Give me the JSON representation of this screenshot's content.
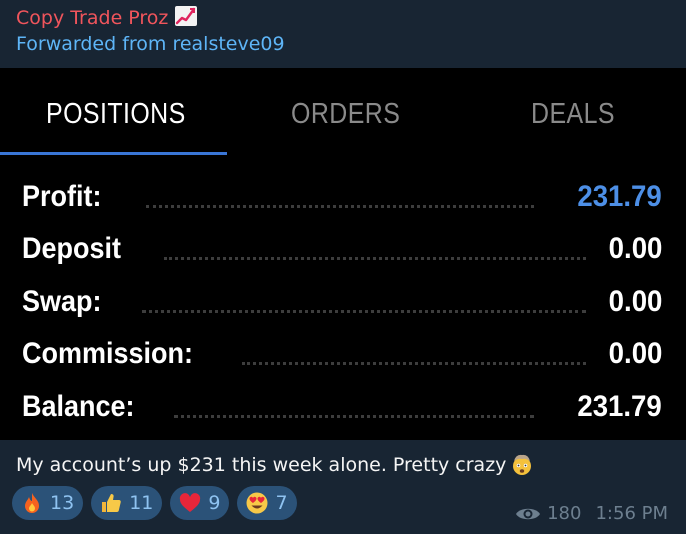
{
  "message": {
    "sender": "Copy Trade Proz",
    "sender_icon": "chart-increasing-icon",
    "forwarded_from": "Forwarded from realsteve09",
    "caption": "My account’s up $231 this week alone. Pretty crazy",
    "caption_emoji": "exploding-head-icon",
    "views": "180",
    "time": "1:56 PM"
  },
  "screenshot": {
    "tabs": [
      {
        "label": "POSITIONS",
        "active": true
      },
      {
        "label": "ORDERS",
        "active": false
      },
      {
        "label": "DEALS",
        "active": false
      }
    ],
    "rows": [
      {
        "label": "Profit:",
        "value": "231.79",
        "color": "#4d8fe6"
      },
      {
        "label": "Deposit",
        "value": "0.00",
        "color": "#ffffff"
      },
      {
        "label": "Swap:",
        "value": "0.00",
        "color": "#ffffff"
      },
      {
        "label": "Commission:",
        "value": "0.00",
        "color": "#ffffff"
      },
      {
        "label": "Balance:",
        "value": "231.79",
        "color": "#ffffff"
      }
    ]
  },
  "reactions": [
    {
      "icon": "fire-icon",
      "count": "13"
    },
    {
      "icon": "thumbs-up-icon",
      "count": "11"
    },
    {
      "icon": "red-heart-icon",
      "count": "9"
    },
    {
      "icon": "heart-eyes-icon",
      "count": "7"
    }
  ],
  "colors": {
    "sender": "#f0555c",
    "forwarded": "#5eb5f7",
    "accent": "#3a76d6",
    "reaction_bg": "#2b5278"
  }
}
